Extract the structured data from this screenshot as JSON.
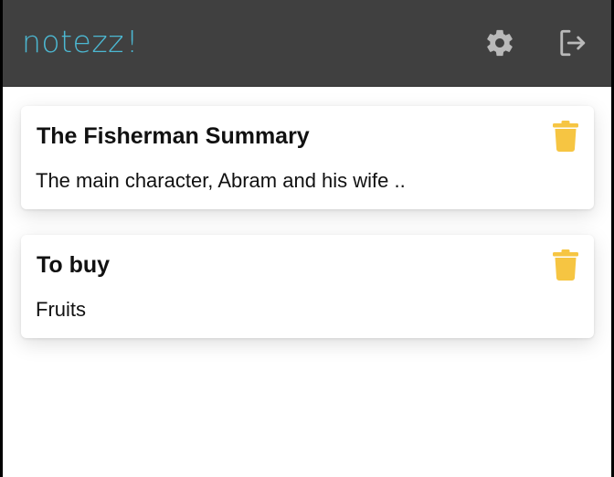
{
  "app": {
    "name": "notezz",
    "name_mark": "!"
  },
  "header": {
    "settings_icon": "gear-icon",
    "logout_icon": "logout-icon"
  },
  "notes": [
    {
      "title": "The Fisherman Summary",
      "body": "The main character, Abram and his wife ..",
      "delete_icon": "trash-icon"
    },
    {
      "title": "To buy",
      "body": "Fruits",
      "delete_icon": "trash-icon"
    }
  ],
  "colors": {
    "appbar": "#404040",
    "logo": "#4cb8d2",
    "header_icons": "#b9b9b9",
    "delete_icon": "#f6c542",
    "background": "#ffffff",
    "text": "#111111"
  }
}
